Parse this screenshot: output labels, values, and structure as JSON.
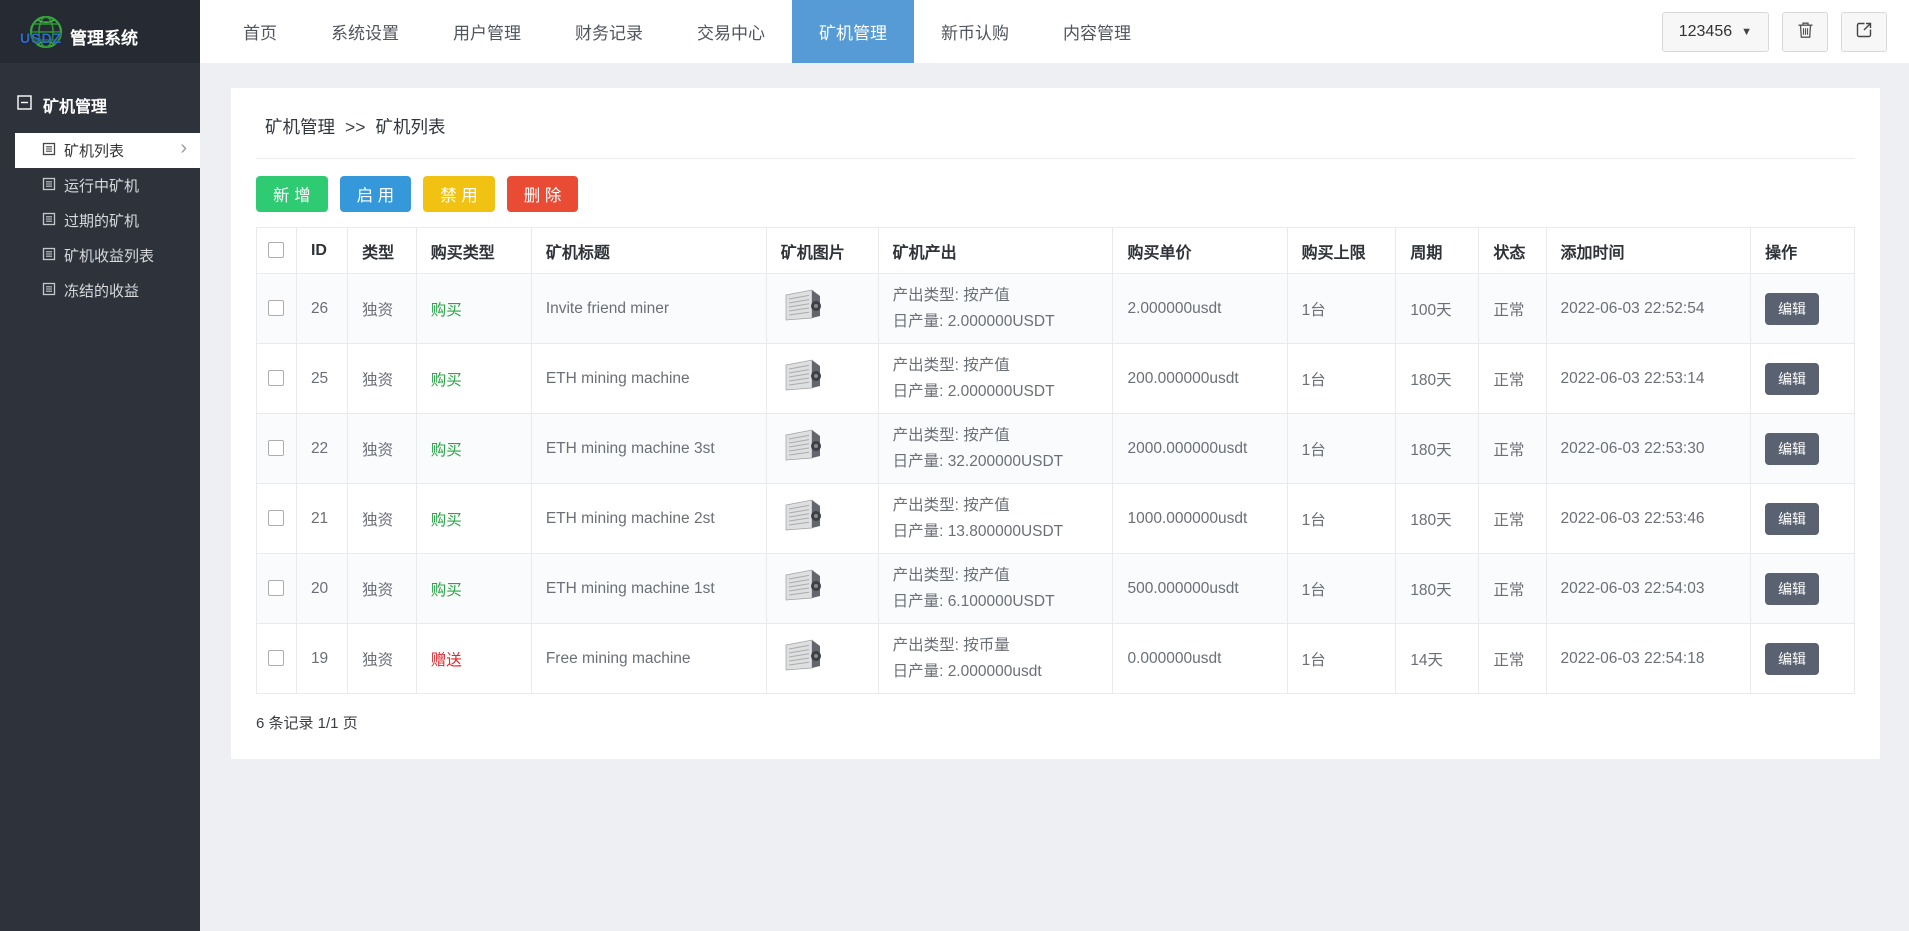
{
  "app": {
    "logo_text": "USDZ",
    "title": "管理系统"
  },
  "topnav": {
    "items": [
      {
        "label": "首页"
      },
      {
        "label": "系统设置"
      },
      {
        "label": "用户管理"
      },
      {
        "label": "财务记录"
      },
      {
        "label": "交易中心"
      },
      {
        "label": "矿机管理",
        "active": true
      },
      {
        "label": "新币认购"
      },
      {
        "label": "内容管理"
      }
    ]
  },
  "user_menu": {
    "username": "123456"
  },
  "sidebar": {
    "section": "矿机管理",
    "items": [
      {
        "label": "矿机列表",
        "active": true
      },
      {
        "label": "运行中矿机"
      },
      {
        "label": "过期的矿机"
      },
      {
        "label": "矿机收益列表"
      },
      {
        "label": "冻结的收益"
      }
    ]
  },
  "breadcrumb": {
    "parent": "矿机管理",
    "separator": ">>",
    "current": "矿机列表"
  },
  "toolbar": {
    "add": "新 增",
    "enable": "启 用",
    "disable": "禁 用",
    "delete": "删 除"
  },
  "table": {
    "headers": [
      {
        "label": "ID"
      },
      {
        "label": "类型"
      },
      {
        "label": "购买类型"
      },
      {
        "label": "矿机标题"
      },
      {
        "label": "矿机图片"
      },
      {
        "label": "矿机产出"
      },
      {
        "label": "购买单价"
      },
      {
        "label": "购买上限"
      },
      {
        "label": "周期"
      },
      {
        "label": "状态"
      },
      {
        "label": "添加时间"
      },
      {
        "label": "操作"
      }
    ],
    "edit_label": "编辑",
    "rows": [
      {
        "id": "26",
        "type": "独资",
        "buy_type": "购买",
        "buy_color": "#28a745",
        "title": "Invite friend miner",
        "output_type": "产出类型: 按产值",
        "daily_output": "日产量: 2.000000USDT",
        "price": "2.000000usdt",
        "limit": "1台",
        "cycle": "100天",
        "status": "正常",
        "time": "2022-06-03 22:52:54"
      },
      {
        "id": "25",
        "type": "独资",
        "buy_type": "购买",
        "buy_color": "#28a745",
        "title": "ETH mining machine",
        "output_type": "产出类型: 按产值",
        "daily_output": "日产量: 2.000000USDT",
        "price": "200.000000usdt",
        "limit": "1台",
        "cycle": "180天",
        "status": "正常",
        "time": "2022-06-03 22:53:14"
      },
      {
        "id": "22",
        "type": "独资",
        "buy_type": "购买",
        "buy_color": "#28a745",
        "title": "ETH mining machine 3st",
        "output_type": "产出类型: 按产值",
        "daily_output": "日产量: 32.200000USDT",
        "price": "2000.000000usdt",
        "limit": "1台",
        "cycle": "180天",
        "status": "正常",
        "time": "2022-06-03 22:53:30"
      },
      {
        "id": "21",
        "type": "独资",
        "buy_type": "购买",
        "buy_color": "#28a745",
        "title": "ETH mining machine 2st",
        "output_type": "产出类型: 按产值",
        "daily_output": "日产量: 13.800000USDT",
        "price": "1000.000000usdt",
        "limit": "1台",
        "cycle": "180天",
        "status": "正常",
        "time": "2022-06-03 22:53:46"
      },
      {
        "id": "20",
        "type": "独资",
        "buy_type": "购买",
        "buy_color": "#28a745",
        "title": "ETH mining machine 1st",
        "output_type": "产出类型: 按产值",
        "daily_output": "日产量: 6.100000USDT",
        "price": "500.000000usdt",
        "limit": "1台",
        "cycle": "180天",
        "status": "正常",
        "time": "2022-06-03 22:54:03"
      },
      {
        "id": "19",
        "type": "独资",
        "buy_type": "赠送",
        "buy_color": "#e7262d",
        "title": "Free mining machine",
        "output_type": "产出类型: 按币量",
        "daily_output": "日产量: 2.000000usdt",
        "price": "0.000000usdt",
        "limit": "1台",
        "cycle": "14天",
        "status": "正常",
        "time": "2022-06-03 22:54:18"
      }
    ]
  },
  "footer": {
    "summary": "6 条记录 1/1 页"
  },
  "colors": {
    "accent_blue": "#569bd5",
    "sidebar_bg": "#2e323b",
    "add_green": "#2fcb73",
    "enable_blue": "#3598db",
    "disable_yellow": "#f2c212",
    "delete_red": "#ea4b35",
    "buy_green": "#28a745",
    "gift_red": "#e7262d",
    "edit_button": "#5a6170"
  }
}
